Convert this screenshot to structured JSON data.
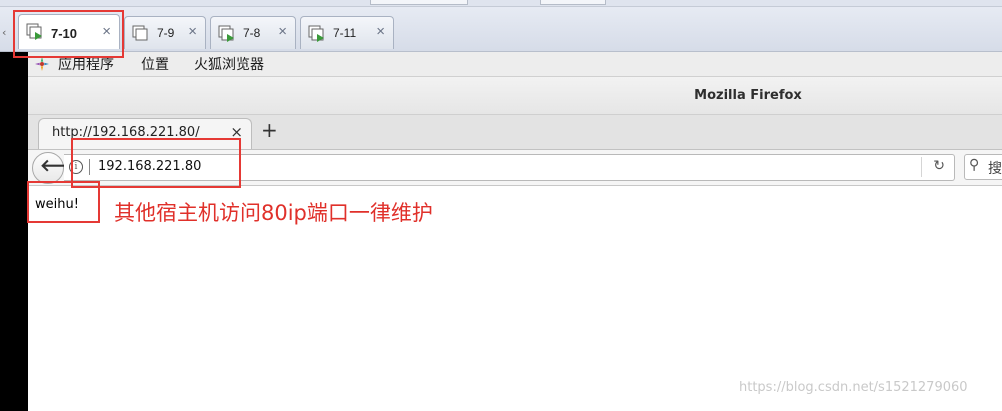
{
  "vm_tabs": [
    {
      "label": "7-10",
      "active": true
    },
    {
      "label": "7-9",
      "active": false
    },
    {
      "label": "7-8",
      "active": false
    },
    {
      "label": "7-11",
      "active": false
    }
  ],
  "vm_tab_close_glyph": "×",
  "gnome_menu": {
    "applications": "应用程序",
    "places": "位置",
    "firefox": "火狐浏览器"
  },
  "window": {
    "title": "Mozilla Firefox"
  },
  "browser": {
    "tab_label": "http://192.168.221.80/",
    "url": "192.168.221.80",
    "search_text": "搜"
  },
  "page": {
    "content": "weihu!"
  },
  "annotation": "其他宿主机访问80ip端口一律维护",
  "watermark": "https://blog.csdn.net/s1521279060",
  "colors": {
    "highlight": "#e53935",
    "annotation": "#e0302a"
  },
  "icons": [
    "vm-icon",
    "close-icon",
    "apps-icon",
    "back-arrow-icon",
    "info-icon",
    "reload-icon",
    "search-icon",
    "new-tab-icon"
  ]
}
